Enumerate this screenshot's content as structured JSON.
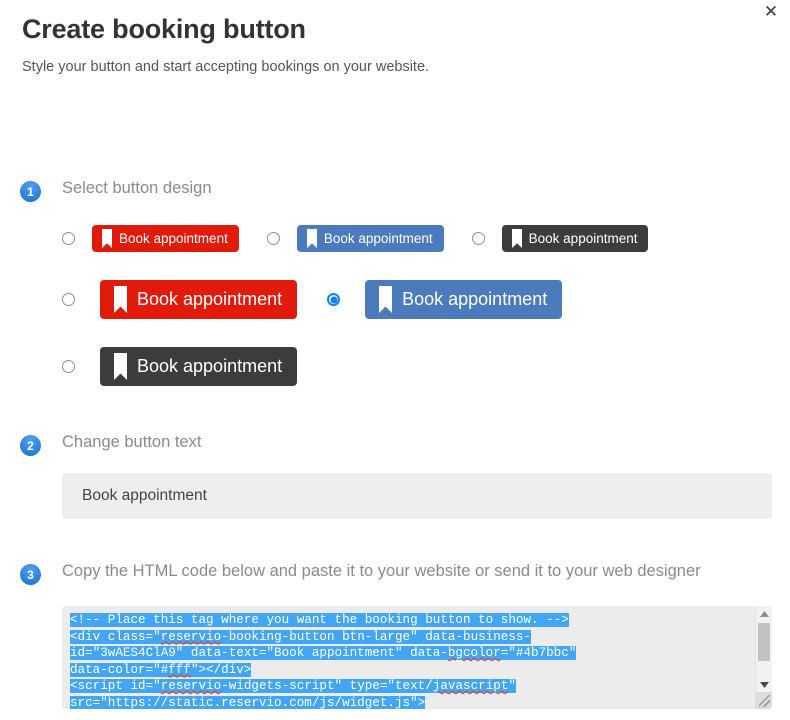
{
  "window": {
    "title": "Create booking button",
    "subtitle": "Style your button and start accepting bookings on your website.",
    "close_label": "✕"
  },
  "colors": {
    "accent": "#1180fa",
    "badge_blue": "#2f86e0",
    "selection_blue": "#43a6f5",
    "red_button": "#e11b0c",
    "blue_button": "#4b7bbc",
    "dark_button": "#3c3c3c",
    "field_bg": "#eeeeee",
    "spellcheck_underline": "#e8392f"
  },
  "steps": [
    {
      "number": "1",
      "label": "Select button design"
    },
    {
      "number": "2",
      "label": "Change button text"
    },
    {
      "number": "3",
      "label": "Copy the HTML code below and paste it to your website or send it to your web designer"
    }
  ],
  "design_options": {
    "icon_name": "bookmark-icon",
    "rows": [
      [
        {
          "id": "red-small",
          "label": "Book appointment",
          "color": "#e11b0c",
          "size": "sm",
          "selected": false
        },
        {
          "id": "blue-small",
          "label": "Book appointment",
          "color": "#4b7bbc",
          "size": "sm",
          "selected": false
        },
        {
          "id": "dark-small",
          "label": "Book appointment",
          "color": "#3c3c3c",
          "size": "sm",
          "selected": false
        }
      ],
      [
        {
          "id": "red-large",
          "label": "Book appointment",
          "color": "#e11b0c",
          "size": "lg",
          "selected": false
        },
        {
          "id": "blue-large",
          "label": "Book appointment",
          "color": "#4b7bbc",
          "size": "lg",
          "selected": true
        }
      ],
      [
        {
          "id": "dark-large",
          "label": "Book appointment",
          "color": "#3c3c3c",
          "size": "lg",
          "selected": false
        }
      ]
    ]
  },
  "button_text_field": {
    "value": "Book appointment",
    "placeholder": "Book appointment"
  },
  "code_box": {
    "selected": true,
    "lines": [
      [
        {
          "t": "<!-- Place this tag where you want the booking button to show. -->",
          "sel": true,
          "sq": false
        }
      ],
      [
        {
          "t": "<div class=\"",
          "sel": true,
          "sq": false
        },
        {
          "t": "reservio",
          "sel": true,
          "sq": true
        },
        {
          "t": "-booking-button btn-large\" data-business-",
          "sel": true,
          "sq": false
        }
      ],
      [
        {
          "t": "id=\"3wAES4ClA9\" data-text=\"Book appointment\" data-",
          "sel": true,
          "sq": false
        },
        {
          "t": "bgcolor",
          "sel": true,
          "sq": true
        },
        {
          "t": "=\"#4b7bbc\"",
          "sel": true,
          "sq": false
        }
      ],
      [
        {
          "t": "data-color=\"#",
          "sel": true,
          "sq": false
        },
        {
          "t": "fff",
          "sel": true,
          "sq": true
        },
        {
          "t": "\"></div>",
          "sel": true,
          "sq": false
        }
      ],
      [
        {
          "t": "<script id=\"",
          "sel": true,
          "sq": false
        },
        {
          "t": "reservio",
          "sel": true,
          "sq": true
        },
        {
          "t": "-widgets-script\" type=\"text/",
          "sel": true,
          "sq": false
        },
        {
          "t": "javascript",
          "sel": true,
          "sq": true
        },
        {
          "t": "\"",
          "sel": true,
          "sq": false
        }
      ],
      [
        {
          "t": "src=\"https://static.reservio.com/js/widget.js\">",
          "sel": true,
          "sq": false
        }
      ]
    ],
    "scrollbar": {
      "up_icon": "triangle-up-icon",
      "down_icon": "triangle-down-icon",
      "resize_icon": "resize-grip-icon"
    }
  }
}
